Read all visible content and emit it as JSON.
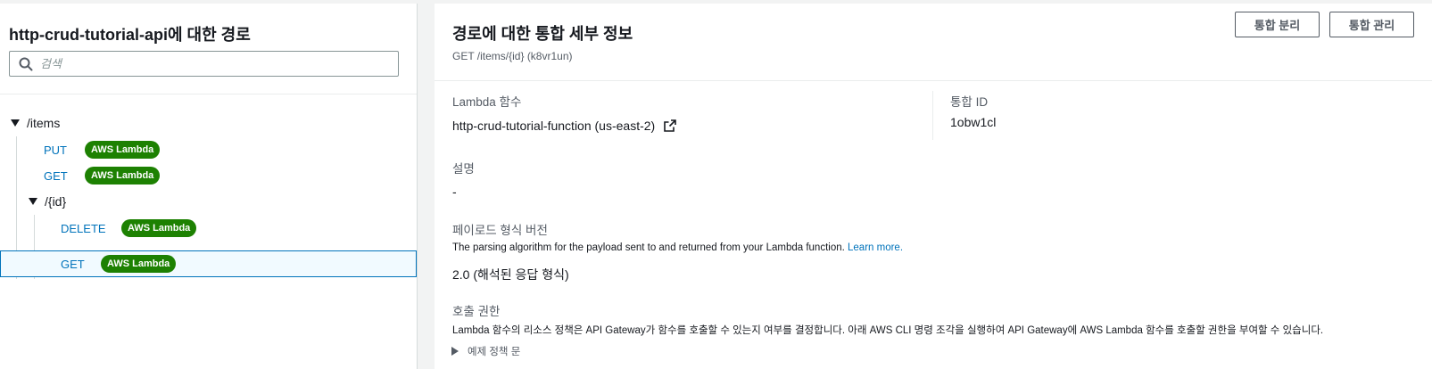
{
  "left_panel": {
    "title": "http-crud-tutorial-api에 대한 경로",
    "search_placeholder": "검색",
    "routes": {
      "items_path": "/items",
      "items_put_method": "PUT",
      "items_put_badge": "AWS Lambda",
      "items_get_method": "GET",
      "items_get_badge": "AWS Lambda",
      "id_path": "/{id}",
      "id_delete_method": "DELETE",
      "id_delete_badge": "AWS Lambda",
      "id_get_method": "GET",
      "id_get_badge": "AWS Lambda"
    }
  },
  "right_panel": {
    "title": "경로에 대한 통합 세부 정보",
    "subtitle": "GET /items/{id} (k8vr1un)",
    "detach_button": "통합 분리",
    "manage_button": "통합 관리",
    "lambda_label": "Lambda 함수",
    "lambda_value": "http-crud-tutorial-function (us-east-2)",
    "integration_id_label": "통합 ID",
    "integration_id_value": "1obw1cl",
    "description_label": "설명",
    "description_value": "-",
    "payload_label": "페이로드 형식 버전",
    "payload_desc": "The parsing algorithm for the payload sent to and returned from your Lambda function.",
    "payload_link": "Learn more.",
    "payload_value": "2.0 (해석된 응답 형식)",
    "invoke_label": "호출 권한",
    "invoke_desc": "Lambda 함수의 리소스 정책은 API Gateway가 함수를 호출할 수 있는지 여부를 결정합니다. 아래 AWS CLI 명령 조각을 실행하여 API Gateway에 AWS Lambda 함수를 호출할 권한을 부여할 수 있습니다.",
    "example_policy": "예제 정책 문"
  },
  "colors": {
    "badge_green": "#1d8102",
    "link_blue": "#0073bb",
    "selected_bg": "#f1faff"
  },
  "icons": [
    "search-icon",
    "caret-down-icon",
    "external-link-icon",
    "caret-right-icon"
  ]
}
